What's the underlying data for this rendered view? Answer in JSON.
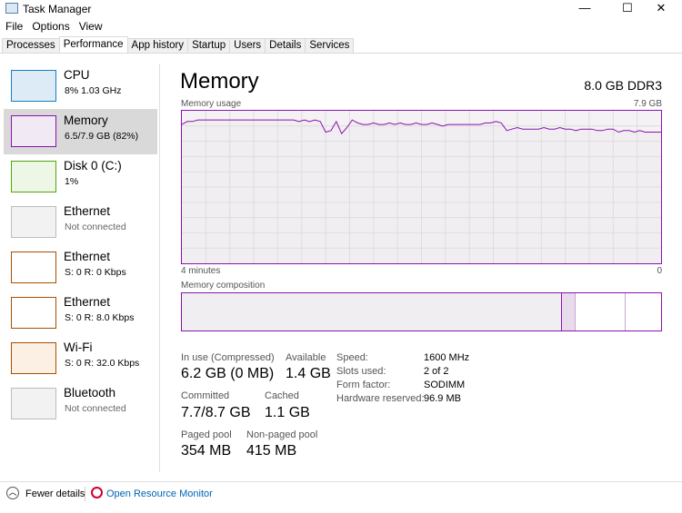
{
  "window": {
    "title": "Task Manager",
    "minimize": "—",
    "maximize": "☐",
    "close": "✕"
  },
  "menu": [
    "File",
    "Options",
    "View"
  ],
  "tabs": [
    "Processes",
    "Performance",
    "App history",
    "Startup",
    "Users",
    "Details",
    "Services"
  ],
  "active_tab": "Performance",
  "sidebar": [
    {
      "name": "CPU",
      "sub": "8%  1.03 GHz",
      "color": "#1a7fc1",
      "fill": "#dcebf6"
    },
    {
      "name": "Memory",
      "sub": "6.5/7.9 GB (82%)",
      "color": "#8b12ae",
      "fill": "#f1e9f3"
    },
    {
      "name": "Disk 0 (C:)",
      "sub": "1%",
      "color": "#4da60c",
      "fill": "#eef7e6"
    },
    {
      "name": "Ethernet",
      "sub": "Not connected",
      "color": "#bdbdbd",
      "fill": "#f2f2f2"
    },
    {
      "name": "Ethernet",
      "sub": "S: 0  R: 0 Kbps",
      "color": "#a74f01",
      "fill": "#fff"
    },
    {
      "name": "Ethernet",
      "sub": "S: 0  R: 8.0 Kbps",
      "color": "#a74f01",
      "fill": "#fff"
    },
    {
      "name": "Wi-Fi",
      "sub": "S: 0  R: 32.0 Kbps",
      "color": "#a74f01",
      "fill": "#fcefe3"
    },
    {
      "name": "Bluetooth",
      "sub": "Not connected",
      "color": "#bdbdbd",
      "fill": "#f2f2f2"
    }
  ],
  "main": {
    "title": "Memory",
    "spec": "8.0 GB DDR3",
    "usage_label": "Memory usage",
    "usage_max": "7.9 GB",
    "time_left": "4 minutes",
    "time_right": "0",
    "composition_label": "Memory composition",
    "usage_percent_history": [
      91,
      93,
      93,
      94,
      94,
      94,
      94,
      94,
      94,
      94,
      94,
      94,
      94,
      94,
      94,
      94,
      94,
      94,
      94,
      94,
      94,
      94,
      93,
      94,
      93,
      94,
      93,
      86,
      87,
      93,
      85,
      89,
      94,
      92,
      91,
      91,
      92,
      91,
      91,
      92,
      91,
      92,
      91,
      91,
      92,
      91,
      91,
      92,
      91,
      90,
      91,
      91,
      91,
      91,
      91,
      91,
      91,
      92,
      92,
      93,
      92,
      87,
      88,
      89,
      88,
      88,
      88,
      88,
      89,
      88,
      88,
      89,
      88,
      88,
      87,
      88,
      88,
      88,
      87,
      87,
      88,
      88,
      86,
      87,
      87,
      86,
      87,
      86,
      86,
      86,
      86
    ],
    "composition": {
      "in_use": 0.793,
      "modified": 0.028,
      "standby": 0.105,
      "free": 0.074
    },
    "stats": {
      "in_use_label": "In use (Compressed)",
      "in_use": "6.2 GB (0 MB)",
      "available_label": "Available",
      "available": "1.4 GB",
      "committed_label": "Committed",
      "committed": "7.7/8.7 GB",
      "cached_label": "Cached",
      "cached": "1.1 GB",
      "paged_label": "Paged pool",
      "paged": "354 MB",
      "nonpaged_label": "Non-paged pool",
      "nonpaged": "415 MB"
    },
    "specs": [
      [
        "Speed:",
        "1600 MHz"
      ],
      [
        "Slots used:",
        "2 of 2"
      ],
      [
        "Form factor:",
        "SODIMM"
      ],
      [
        "Hardware reserved:",
        "96.9 MB"
      ]
    ]
  },
  "footer": {
    "fewer": "Fewer details",
    "monitor": "Open Resource Monitor"
  }
}
